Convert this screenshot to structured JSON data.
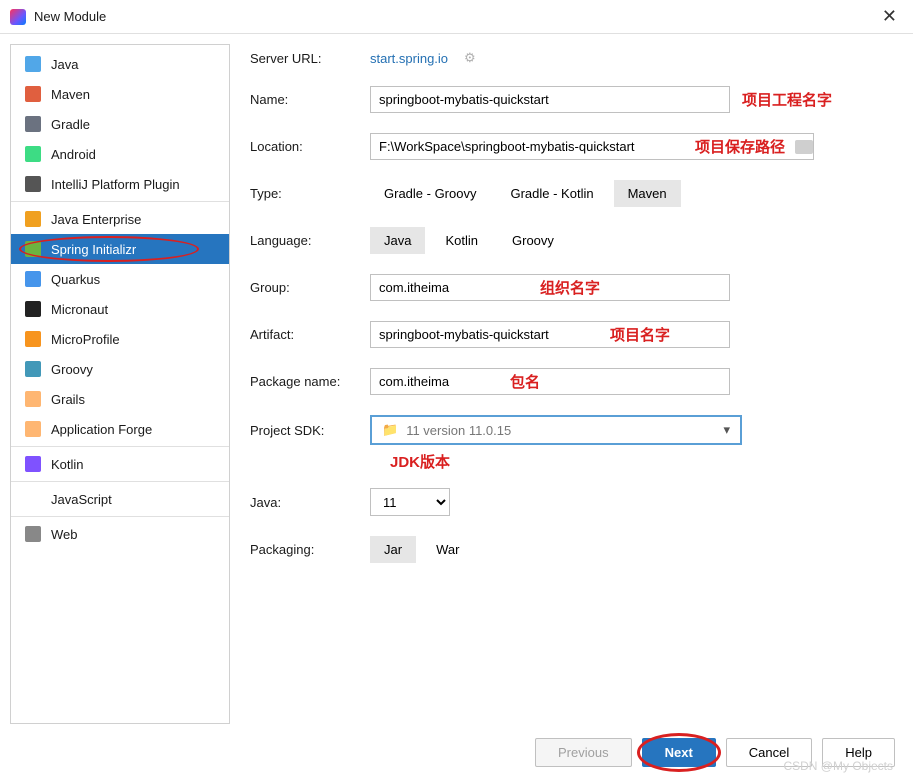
{
  "window": {
    "title": "New Module"
  },
  "sidebar": {
    "groups": [
      {
        "items": [
          {
            "id": "java",
            "label": "Java",
            "icon_color": "#51a7e8"
          },
          {
            "id": "maven",
            "label": "Maven",
            "icon_color": "#e05f3f"
          },
          {
            "id": "gradle",
            "label": "Gradle",
            "icon_color": "#6b7280"
          },
          {
            "id": "android",
            "label": "Android",
            "icon_color": "#3ddc84"
          },
          {
            "id": "intellij-plugin",
            "label": "IntelliJ Platform Plugin",
            "icon_color": "#555"
          }
        ]
      },
      {
        "items": [
          {
            "id": "java-enterprise",
            "label": "Java Enterprise",
            "icon_color": "#f0a020"
          },
          {
            "id": "spring-initializr",
            "label": "Spring Initializr",
            "icon_color": "#6db33f",
            "selected": true,
            "circled": true
          },
          {
            "id": "quarkus",
            "label": "Quarkus",
            "icon_color": "#4695eb"
          },
          {
            "id": "micronaut",
            "label": "Micronaut",
            "icon_color": "#222"
          },
          {
            "id": "microprofile",
            "label": "MicroProfile",
            "icon_color": "#f7941e"
          },
          {
            "id": "groovy",
            "label": "Groovy",
            "icon_color": "#4298b8"
          },
          {
            "id": "grails",
            "label": "Grails",
            "icon_color": "#feb672"
          },
          {
            "id": "application-forge",
            "label": "Application Forge",
            "icon_color": "#feb672"
          }
        ]
      },
      {
        "items": [
          {
            "id": "kotlin",
            "label": "Kotlin",
            "icon_color": "#7f52ff"
          }
        ]
      },
      {
        "items": [
          {
            "id": "javascript",
            "label": "JavaScript",
            "icon_color": ""
          }
        ]
      },
      {
        "items": [
          {
            "id": "web",
            "label": "Web",
            "icon_color": "#888"
          }
        ]
      }
    ]
  },
  "form": {
    "server_url_label": "Server URL:",
    "server_url": "start.spring.io",
    "name_label": "Name:",
    "name": "springboot-mybatis-quickstart",
    "name_annotation": "项目工程名字",
    "location_label": "Location:",
    "location": "F:\\WorkSpace\\springboot-mybatis-quickstart",
    "location_annotation": "项目保存路径",
    "type_label": "Type:",
    "type_options": [
      "Gradle - Groovy",
      "Gradle - Kotlin",
      "Maven"
    ],
    "type_selected": "Maven",
    "language_label": "Language:",
    "language_options": [
      "Java",
      "Kotlin",
      "Groovy"
    ],
    "language_selected": "Java",
    "group_label": "Group:",
    "group": "com.itheima",
    "group_annotation": "组织名字",
    "artifact_label": "Artifact:",
    "artifact": "springboot-mybatis-quickstart",
    "artifact_annotation": "项目名字",
    "package_label": "Package name:",
    "package": "com.itheima",
    "package_annotation": "包名",
    "sdk_label": "Project SDK:",
    "sdk_value": "11 version 11.0.15",
    "sdk_annotation": "JDK版本",
    "java_label": "Java:",
    "java_value": "11",
    "packaging_label": "Packaging:",
    "packaging_options": [
      "Jar",
      "War"
    ],
    "packaging_selected": "Jar"
  },
  "buttons": {
    "previous": "Previous",
    "next": "Next",
    "cancel": "Cancel",
    "help": "Help"
  },
  "watermark": "CSDN @My Objects"
}
